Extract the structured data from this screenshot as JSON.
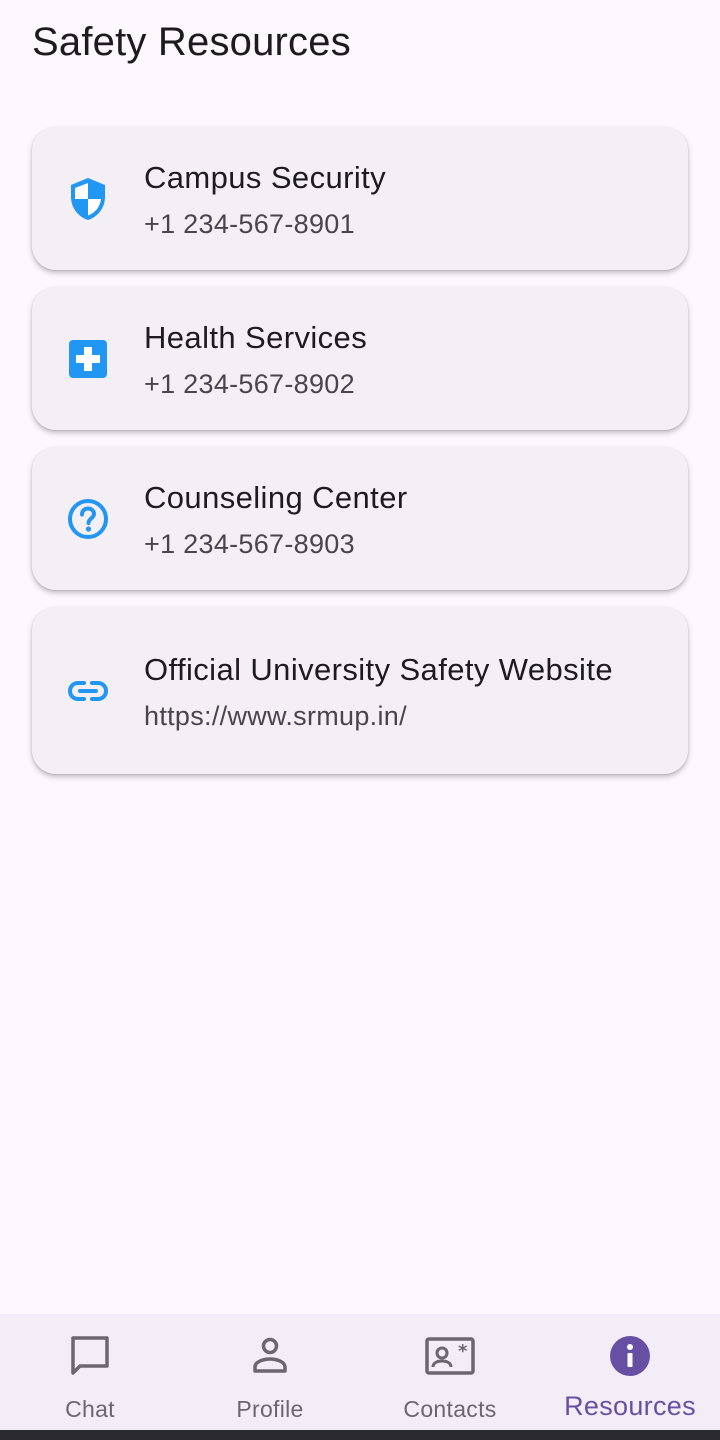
{
  "page": {
    "title": "Safety Resources"
  },
  "resources": [
    {
      "title": "Campus Security",
      "subtitle": "+1 234-567-8901",
      "icon": "shield-icon"
    },
    {
      "title": "Health Services",
      "subtitle": "+1 234-567-8902",
      "icon": "medical-cross-icon"
    },
    {
      "title": "Counseling Center",
      "subtitle": "+1 234-567-8903",
      "icon": "help-circle-icon"
    },
    {
      "title": "Official University Safety Website",
      "subtitle": "https://www.srmup.in/",
      "icon": "link-icon"
    }
  ],
  "nav": {
    "items": [
      {
        "label": "Chat",
        "icon": "chat-bubble-icon"
      },
      {
        "label": "Profile",
        "icon": "person-icon"
      },
      {
        "label": "Contacts",
        "icon": "contact-card-icon"
      },
      {
        "label": "Resources",
        "icon": "info-icon"
      }
    ],
    "active": "Resources"
  },
  "colors": {
    "accent": "#2196f3",
    "active_nav": "#6750a4",
    "background": "#fdf7fe",
    "card": "#f4eff5"
  }
}
